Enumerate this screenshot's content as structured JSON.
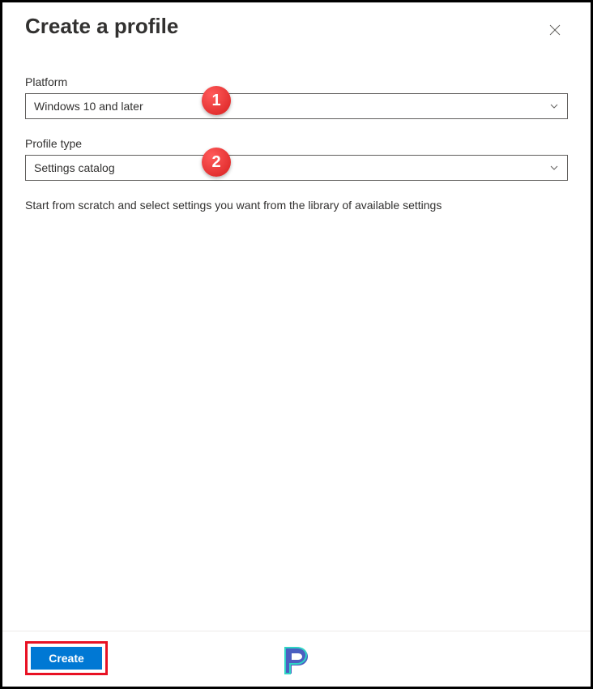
{
  "header": {
    "title": "Create a profile"
  },
  "fields": {
    "platform": {
      "label": "Platform",
      "value": "Windows 10 and later",
      "badge": "1"
    },
    "profileType": {
      "label": "Profile type",
      "value": "Settings catalog",
      "badge": "2"
    }
  },
  "description": "Start from scratch and select settings you want from the library of available settings",
  "footer": {
    "createLabel": "Create"
  }
}
